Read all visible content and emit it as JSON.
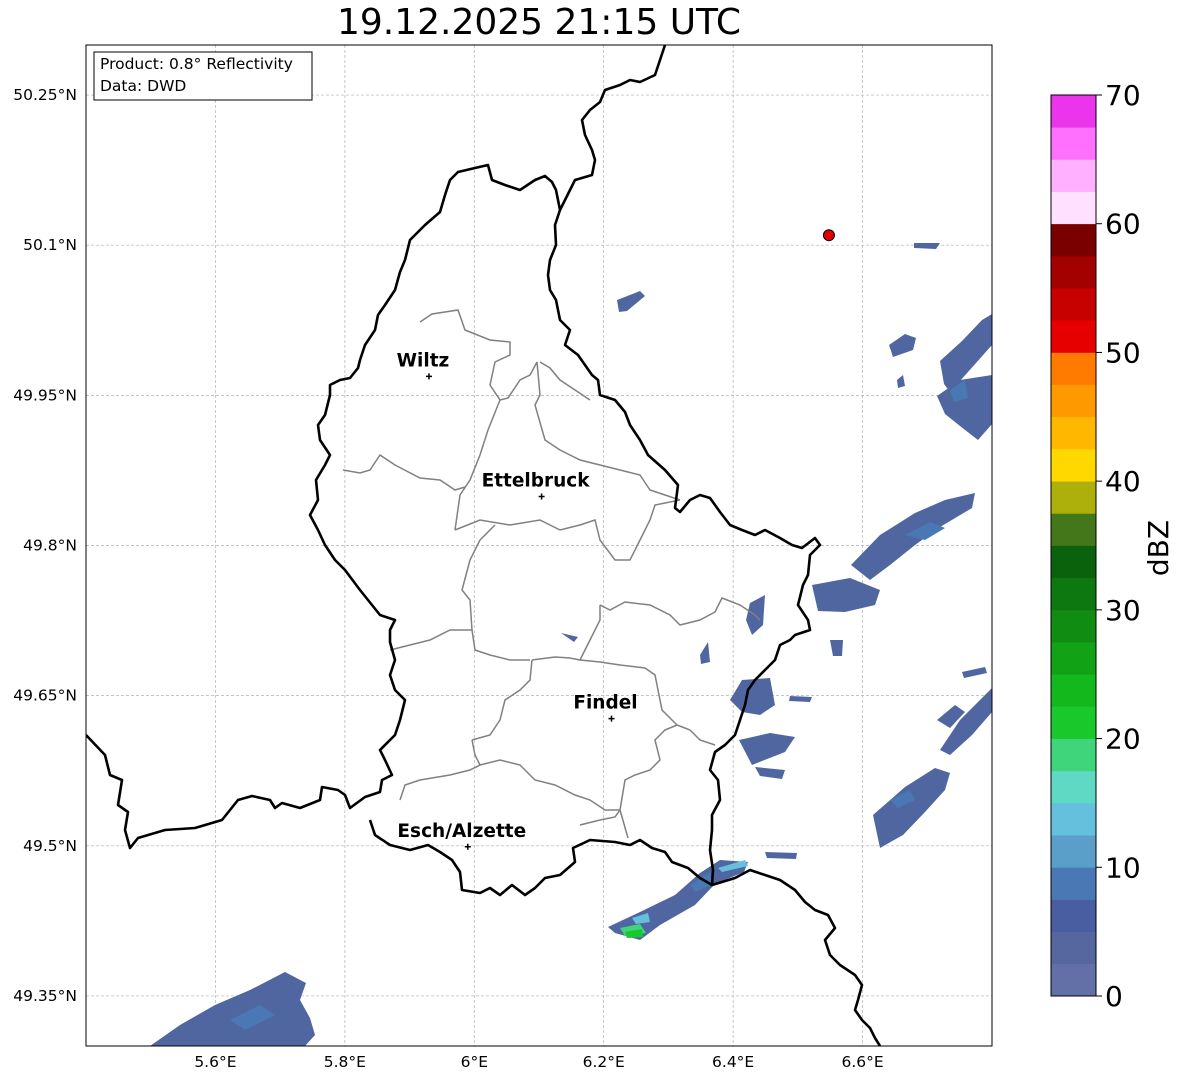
{
  "title": "19.12.2025 21:15 UTC",
  "info_box": {
    "product": "Product: 0.8° Reflectivity",
    "data": "Data: DWD"
  },
  "map": {
    "lon_range": [
      5.4,
      6.8
    ],
    "lat_range": [
      49.3,
      50.3
    ],
    "lon_ticks": [
      "5.6°E",
      "5.8°E",
      "6°E",
      "6.2°E",
      "6.4°E",
      "6.6°E"
    ],
    "lon_tick_values": [
      5.6,
      5.8,
      6.0,
      6.2,
      6.4,
      6.6
    ],
    "lat_ticks": [
      "50.25°N",
      "50.1°N",
      "49.95°N",
      "49.8°N",
      "49.65°N",
      "49.5°N",
      "49.35°N"
    ],
    "lat_tick_values": [
      50.25,
      50.1,
      49.95,
      49.8,
      49.65,
      49.5,
      49.35
    ],
    "grid": true,
    "cities": [
      {
        "name": "Wiltz",
        "lon": 5.93,
        "lat": 49.969
      },
      {
        "name": "Ettelbruck",
        "lon": 6.104,
        "lat": 49.849
      },
      {
        "name": "Findel",
        "lon": 6.212,
        "lat": 49.627
      },
      {
        "name": "Esch/Alzette",
        "lon": 5.99,
        "lat": 49.499
      }
    ],
    "radar_site": {
      "lon": 6.548,
      "lat": 50.11,
      "color": "#e00000"
    }
  },
  "colorbar": {
    "label": "dBZ",
    "tick_labels": [
      "0",
      "10",
      "20",
      "30",
      "40",
      "50",
      "60",
      "70"
    ],
    "tick_values": [
      0,
      10,
      20,
      30,
      40,
      50,
      60,
      70
    ],
    "range": [
      0,
      70
    ],
    "step": 2.5,
    "colors": [
      "#6370a8",
      "#56679f",
      "#485ea0",
      "#4a78b5",
      "#5a9fca",
      "#65c0de",
      "#5fd8c4",
      "#3fd57a",
      "#19c92c",
      "#13b81d",
      "#12a215",
      "#108c12",
      "#0d7710",
      "#0b620d",
      "#43771a",
      "#adb00a",
      "#ffd800",
      "#ffb700",
      "#ff9900",
      "#ff7b00",
      "#e60000",
      "#c70000",
      "#a30000",
      "#7a0000",
      "#ffe0ff",
      "#ffb0ff",
      "#ff70ff",
      "#ec34ec"
    ]
  }
}
